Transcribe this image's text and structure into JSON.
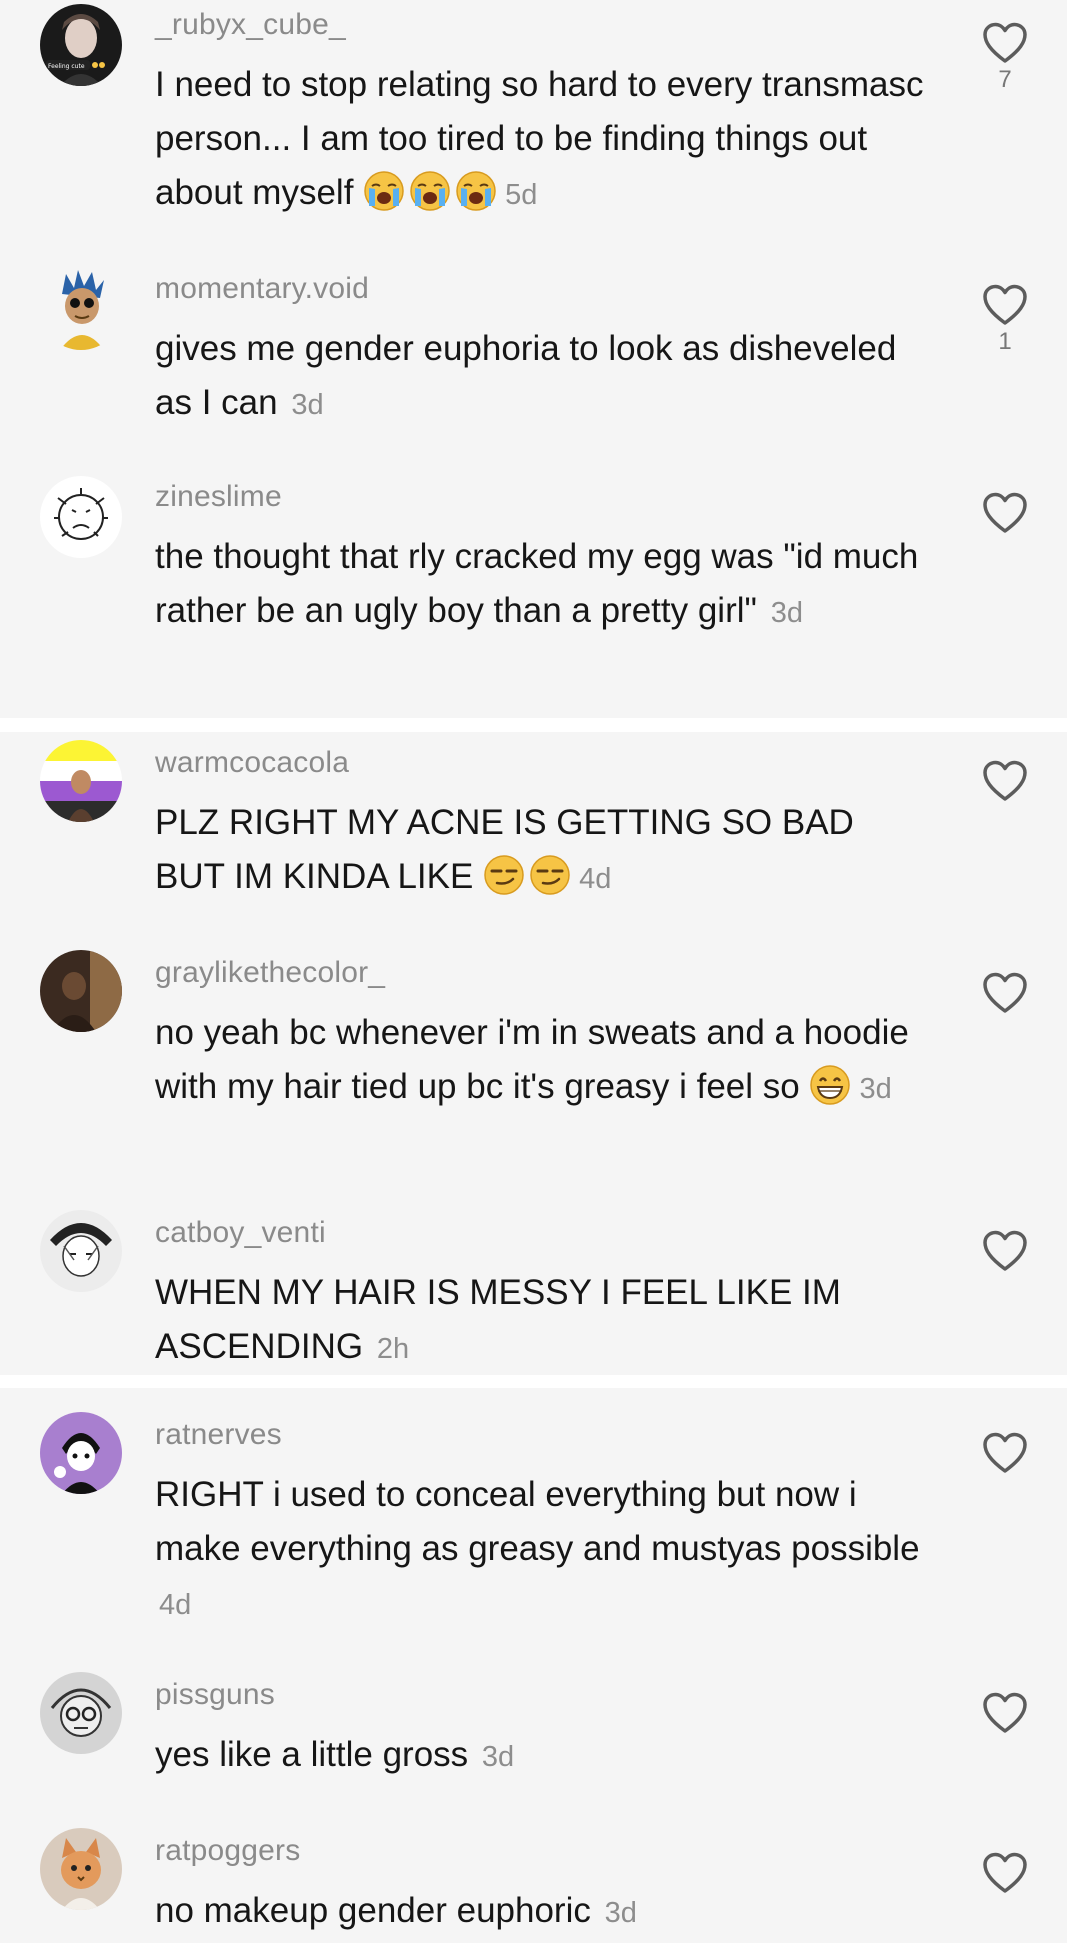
{
  "panel1": {
    "comments": [
      {
        "username": "_rubyx_cube_",
        "text": "I need to stop relating so hard to every transmasc person... I am too tired to be finding things out about myself",
        "emojis": [
          "loudly-crying-face",
          "loudly-crying-face",
          "loudly-crying-face"
        ],
        "age": "5d",
        "likes": "7",
        "avatar": "profile-photo-icon"
      },
      {
        "username": "momentary.void",
        "text": "gives me gender euphoria to look as disheveled as I can",
        "emojis": [],
        "age": "3d",
        "likes": "1",
        "avatar": "cartoon-character-icon"
      },
      {
        "username": "zineslime",
        "text": "the thought that rly cracked my egg was \"id much rather be an ugly boy than a pretty girl\"",
        "emojis": [],
        "age": "3d",
        "likes": "",
        "avatar": "doodle-face-icon"
      }
    ]
  },
  "panel2": {
    "comments": [
      {
        "username": "warmcocacola",
        "text": "PLZ RIGHT MY ACNE IS GETTING SO BAD BUT IM KINDA LIKE",
        "emojis": [
          "smirking-face",
          "smirking-face"
        ],
        "age": "4d",
        "likes": "",
        "avatar": "nonbinary-flag-photo-icon"
      },
      {
        "username": "graylikethecolor_",
        "text": "no yeah bc whenever i'm in sweats and a hoodie with my hair tied up bc it's greasy i feel so",
        "emojis": [
          "grinning-face"
        ],
        "age": "3d",
        "likes": "",
        "avatar": "dark-photo-icon"
      },
      {
        "username": "catboy_venti",
        "text": "WHEN MY HAIR IS MESSY I FEEL LIKE IM ASCENDING",
        "emojis": [],
        "age": "2h",
        "likes": "",
        "avatar": "anime-sketch-icon"
      }
    ]
  },
  "panel3": {
    "comments": [
      {
        "username": "ratnerves",
        "text": "RIGHT i used to conceal everything but now i make everything as greasy and mustyas possible",
        "emojis": [],
        "age": "4d",
        "likes": "",
        "avatar": "anime-purple-icon"
      },
      {
        "username": "pissguns",
        "text": "yes like a little gross",
        "emojis": [],
        "age": "3d",
        "likes": "",
        "avatar": "sketch-face-icon"
      },
      {
        "username": "ratpoggers",
        "text": "no makeup gender euphoric",
        "emojis": [],
        "age": "3d",
        "likes": "",
        "avatar": "cat-photo-icon"
      }
    ]
  },
  "colors": {
    "panel_bg": "#f5f5f5",
    "separator": "#ffffff",
    "username": "#8a8a8a",
    "text": "#161616",
    "age": "#8d8d8d"
  }
}
